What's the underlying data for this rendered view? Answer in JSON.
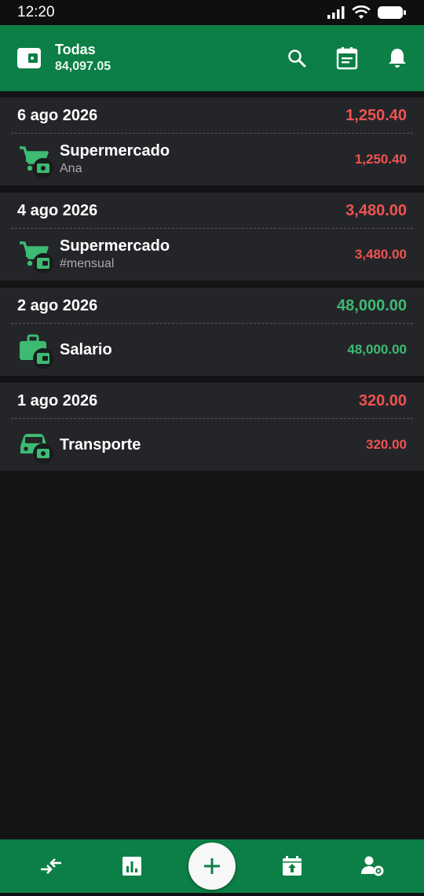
{
  "status": {
    "time": "12:20"
  },
  "header": {
    "account_name": "Todas",
    "account_balance": "84,097.05",
    "colors": {
      "brand": "#0b7f45"
    }
  },
  "groups": [
    {
      "date": "6 ago 2026",
      "total": "1,250.40",
      "kind": "expense",
      "transactions": [
        {
          "icon": "cart-icon",
          "title": "Supermercado",
          "subtitle": "Ana",
          "amount": "1,250.40",
          "kind": "expense",
          "account_icon": "cash-icon"
        }
      ]
    },
    {
      "date": "4 ago 2026",
      "total": "3,480.00",
      "kind": "expense",
      "transactions": [
        {
          "icon": "cart-icon",
          "title": "Supermercado",
          "subtitle": "#mensual",
          "amount": "3,480.00",
          "kind": "expense",
          "account_icon": "wallet-icon"
        }
      ]
    },
    {
      "date": "2 ago 2026",
      "total": "48,000.00",
      "kind": "income",
      "transactions": [
        {
          "icon": "briefcase-icon",
          "title": "Salario",
          "subtitle": "",
          "amount": "48,000.00",
          "kind": "income",
          "account_icon": "wallet-icon"
        }
      ]
    },
    {
      "date": "1 ago 2026",
      "total": "320.00",
      "kind": "expense",
      "transactions": [
        {
          "icon": "car-icon",
          "title": "Transporte",
          "subtitle": "",
          "amount": "320.00",
          "kind": "expense",
          "account_icon": "cash-icon"
        }
      ]
    }
  ],
  "colors": {
    "expense": "#ef5350",
    "income": "#3dbb73",
    "background": "#141416",
    "card": "#242528"
  }
}
